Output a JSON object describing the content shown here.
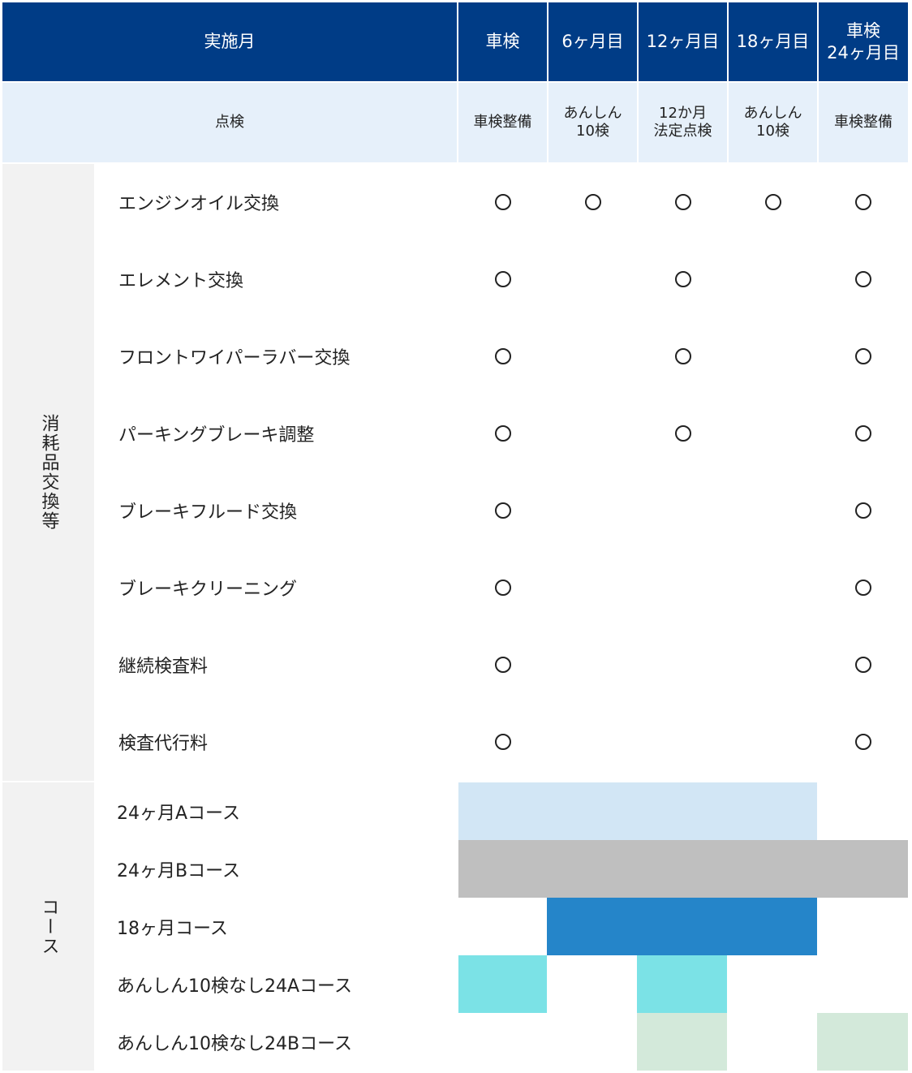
{
  "header": {
    "month_label": "実施月",
    "columns": [
      "車検",
      "6ヶ月目",
      "12ヶ月目",
      "18ヶ月目",
      "車検\n24ヶ月目"
    ]
  },
  "inspection": {
    "label": "点検",
    "columns": [
      "車検整備",
      "あんしん\n10検",
      "12か月\n法定点検",
      "あんしん\n10検",
      "車検整備"
    ]
  },
  "consumables": {
    "group_label": "消耗品交換等",
    "rows": [
      {
        "label": "エンジンオイル交換",
        "marks": [
          true,
          true,
          true,
          true,
          true
        ]
      },
      {
        "label": "エレメント交換",
        "marks": [
          true,
          false,
          true,
          false,
          true
        ]
      },
      {
        "label": "フロントワイパーラバー交換",
        "marks": [
          true,
          false,
          true,
          false,
          true
        ]
      },
      {
        "label": "パーキングブレーキ調整",
        "marks": [
          true,
          false,
          true,
          false,
          true
        ]
      },
      {
        "label": "ブレーキフルード交換",
        "marks": [
          true,
          false,
          false,
          false,
          true
        ]
      },
      {
        "label": "ブレーキクリーニング",
        "marks": [
          true,
          false,
          false,
          false,
          true
        ]
      },
      {
        "label": "継続検査料",
        "marks": [
          true,
          false,
          false,
          false,
          true
        ]
      },
      {
        "label": "検査代行料",
        "marks": [
          true,
          false,
          false,
          false,
          true
        ]
      }
    ]
  },
  "courses": {
    "group_label": "コース",
    "rows": [
      {
        "label": "24ヶ月Aコース",
        "color": "#d2e6f5",
        "cells": [
          true,
          true,
          true,
          true,
          false
        ]
      },
      {
        "label": "24ヶ月Bコース",
        "color": "#bfbfbf",
        "cells": [
          true,
          true,
          true,
          true,
          true
        ]
      },
      {
        "label": "18ヶ月コース",
        "color": "#2585c9",
        "cells": [
          false,
          true,
          true,
          true,
          false
        ]
      },
      {
        "label": "あんしん10検なし24Aコース",
        "color": "#7be2e6",
        "cells": [
          true,
          false,
          true,
          false,
          false
        ]
      },
      {
        "label": "あんしん10検なし24Bコース",
        "color": "#d3e9da",
        "cells": [
          false,
          false,
          true,
          false,
          true
        ]
      }
    ]
  },
  "mark_icon": "circle-mark-icon"
}
